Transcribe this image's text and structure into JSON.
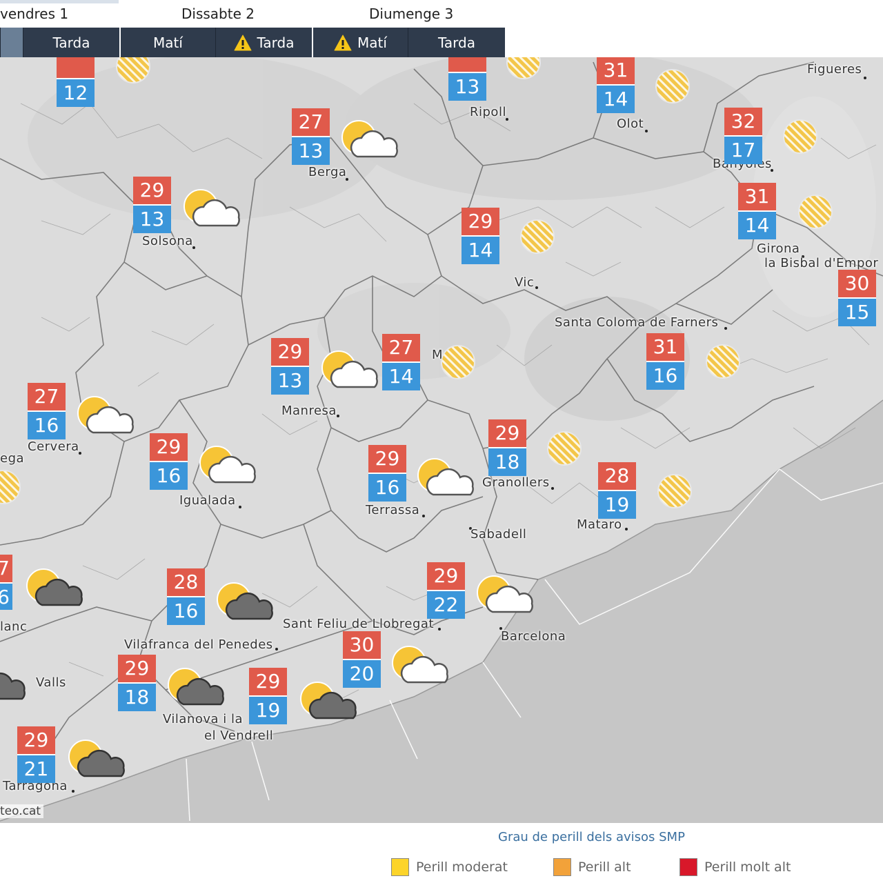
{
  "days": [
    {
      "label": "vendres 1"
    },
    {
      "label": "Dissabte 2"
    },
    {
      "label": "Diumenge 3"
    }
  ],
  "periods": [
    {
      "label": "",
      "warning": false,
      "active": true
    },
    {
      "label": "Tarda",
      "warning": false,
      "active": false
    },
    {
      "label": "Matí",
      "warning": false,
      "active": false
    },
    {
      "label": "Tarda",
      "warning": true,
      "active": false
    },
    {
      "label": "Matí",
      "warning": true,
      "active": false
    },
    {
      "label": "Tarda",
      "warning": false,
      "active": false
    }
  ],
  "cities": [
    {
      "name": "Figueres"
    },
    {
      "name": "Ripoll"
    },
    {
      "name": "Olot"
    },
    {
      "name": "Berga"
    },
    {
      "name": "Banyoles"
    },
    {
      "name": "Solsona"
    },
    {
      "name": "Girona"
    },
    {
      "name": "la Bisbal d'Empor"
    },
    {
      "name": "Vic"
    },
    {
      "name": "Santa Coloma de Farners"
    },
    {
      "name": "M"
    },
    {
      "name": "Manresa"
    },
    {
      "name": "Cervera"
    },
    {
      "name": "ega"
    },
    {
      "name": "Igualada"
    },
    {
      "name": "Granollers"
    },
    {
      "name": "Terrassa"
    },
    {
      "name": "Sabadell"
    },
    {
      "name": "Mataro"
    },
    {
      "name": "lanc"
    },
    {
      "name": "Sant Feliu de Llobregat"
    },
    {
      "name": "Barcelona"
    },
    {
      "name": "Vilafranca del Penedes"
    },
    {
      "name": "Valls"
    },
    {
      "name": "Vilanova i la"
    },
    {
      "name": "el Vendrell"
    },
    {
      "name": "Tarragona"
    }
  ],
  "temps": [
    {
      "max": "",
      "min": "12"
    },
    {
      "max": "",
      "min": "13"
    },
    {
      "max": "31",
      "min": "14"
    },
    {
      "max": "27",
      "min": "13"
    },
    {
      "max": "32",
      "min": "17"
    },
    {
      "max": "29",
      "min": "13"
    },
    {
      "max": "31",
      "min": "14"
    },
    {
      "max": "29",
      "min": "14"
    },
    {
      "max": "30",
      "min": "15"
    },
    {
      "max": "29",
      "min": "13"
    },
    {
      "max": "27",
      "min": "14"
    },
    {
      "max": "31",
      "min": "16"
    },
    {
      "max": "27",
      "min": "16"
    },
    {
      "max": "29",
      "min": "16"
    },
    {
      "max": "29",
      "min": "18"
    },
    {
      "max": "29",
      "min": "16"
    },
    {
      "max": "28",
      "min": "19"
    },
    {
      "max": "7",
      "min": "6"
    },
    {
      "max": "28",
      "min": "16"
    },
    {
      "max": "29",
      "min": "22"
    },
    {
      "max": "30",
      "min": "20"
    },
    {
      "max": "29",
      "min": "18"
    },
    {
      "max": "29",
      "min": "19"
    },
    {
      "max": "29",
      "min": "21"
    }
  ],
  "weather_icons": [
    "haze-icon",
    "haze-icon",
    "haze-icon",
    "sun-cloud-icon",
    "haze-icon",
    "sun-cloud-icon",
    "haze-icon",
    "haze-icon",
    "sun-cloud-icon",
    "haze-icon",
    "haze-icon",
    "sun-cloud-icon",
    "haze-icon",
    "sun-cloud-icon",
    "haze-icon",
    "sun-cloud-icon",
    "haze-icon",
    "sun-dark-cloud-icon",
    "sun-dark-cloud-icon",
    "sun-cloud-icon",
    "dark-cloud-icon",
    "sun-cloud-icon",
    "sun-dark-cloud-icon",
    "sun-dark-cloud-icon",
    "sun-dark-cloud-icon"
  ],
  "credit": "teo.cat",
  "legend": {
    "title": "Grau de perill dels avisos SMP",
    "items": [
      {
        "label": "Perill moderat",
        "color": "#fcd42a"
      },
      {
        "label": "Perill alt",
        "color": "#f2a23a"
      },
      {
        "label": "Perill molt alt",
        "color": "#d8182a"
      }
    ]
  },
  "colors": {
    "max_temp": "#e05a4b",
    "min_temp": "#3b96da",
    "nav_bar": "#2f3b4c",
    "warning": "#f5c518"
  }
}
